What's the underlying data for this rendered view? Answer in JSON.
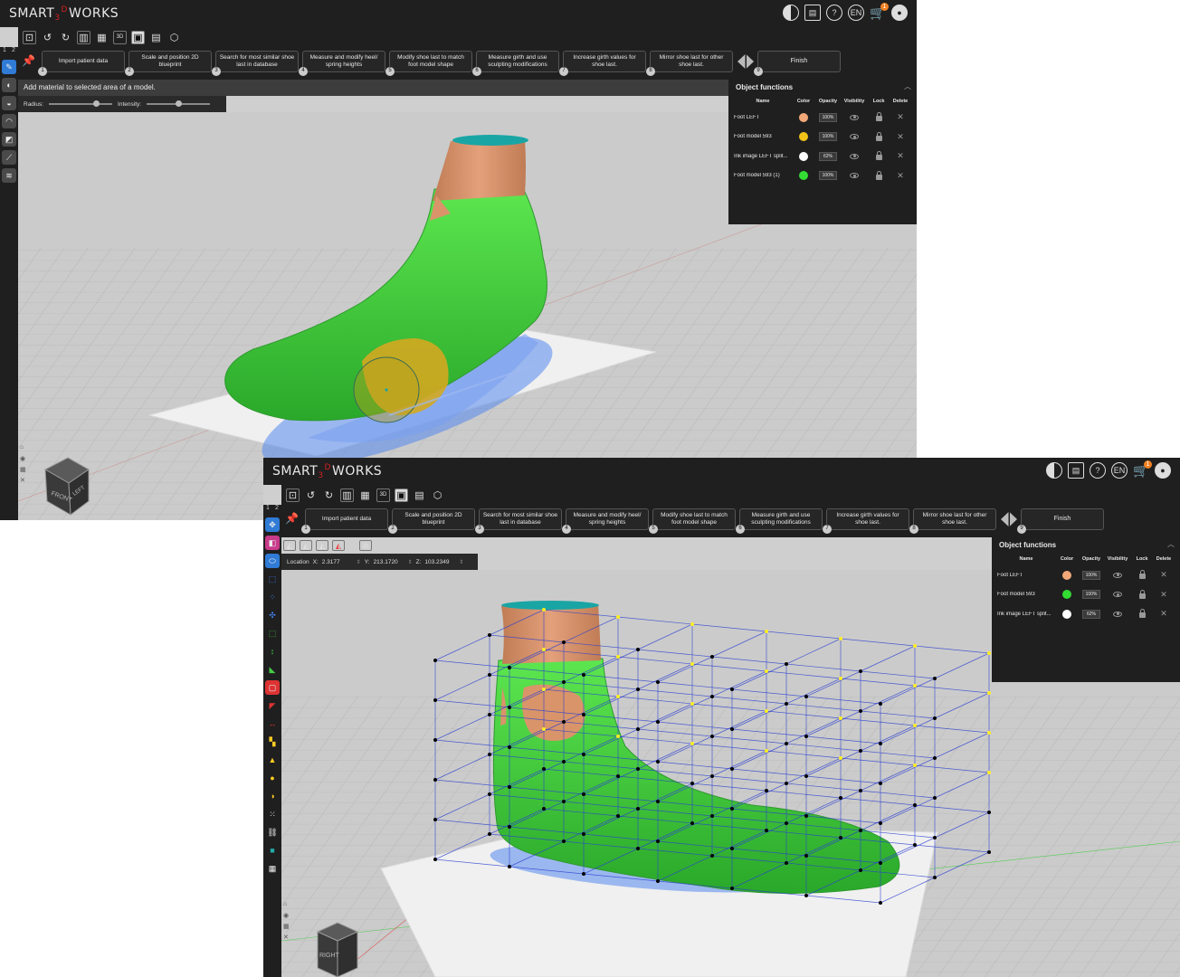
{
  "app": {
    "logo": {
      "pre": "SMART",
      "sub": "3",
      "sup": "D",
      "post": "WORKS"
    },
    "cart_count": "1",
    "language": "EN"
  },
  "steps": [
    {
      "num": "1",
      "label": "Import patient data"
    },
    {
      "num": "2",
      "label": "Scale and position 2D blueprint"
    },
    {
      "num": "3",
      "label": "Search for most similar shoe last in database"
    },
    {
      "num": "4",
      "label": "Measure and modify heel/ spring heights"
    },
    {
      "num": "5",
      "label": "Modify shoe last to match foot model shape"
    },
    {
      "num": "6",
      "label": "Measure girth and use sculpting modifications"
    },
    {
      "num": "7",
      "label": "Increase girth values for shoe last."
    },
    {
      "num": "8",
      "label": "Mirror shoe last for other shoe last."
    },
    {
      "num": "9",
      "label": "Finish"
    }
  ],
  "left_tabs": [
    "1",
    "2"
  ],
  "toolbar_3d_label": "3D",
  "window1": {
    "hint": "Add material to selected area of a model.",
    "radius_label": "Radius:",
    "intensity_label": "Intensity:",
    "radius_value": 0.75,
    "intensity_value": 0.5,
    "navcube": {
      "face1": "FRONT",
      "face2": "LEFT"
    }
  },
  "window2": {
    "location_label": "Location",
    "x_label": "X:",
    "x_value": "2.3177",
    "y_label": "Y:",
    "y_value": "213.1720",
    "z_label": "Z:",
    "z_value": "103.2349",
    "navcube": {
      "face1": "RIGHT"
    }
  },
  "object_panel": {
    "title": "Object functions",
    "columns": {
      "name": "Name",
      "color": "Color",
      "opacity": "Opacity",
      "visibility": "Visibility",
      "lock": "Lock",
      "delete": "Delete"
    }
  },
  "objects_w1": [
    {
      "name": "Foot LEFT",
      "color": "#f2a878",
      "opacity": "100%"
    },
    {
      "name": "Foot model 593",
      "color": "#f2c21a",
      "opacity": "100%"
    },
    {
      "name": "Ink image LEFT split...",
      "color": "#ffffff",
      "opacity": "62%"
    },
    {
      "name": "Foot model 593 (1)",
      "color": "#33dd33",
      "opacity": "100%"
    }
  ],
  "objects_w2": [
    {
      "name": "Foot LEFT",
      "color": "#f2a878",
      "opacity": "100%"
    },
    {
      "name": "Foot model 593",
      "color": "#33dd33",
      "opacity": "100%"
    },
    {
      "name": "Ink image LEFT split...",
      "color": "#ffffff",
      "opacity": "62%"
    }
  ],
  "colors": {
    "foot_green": "#3fd03a",
    "skin": "#d9946a",
    "cuff": "#1aa5a5",
    "ink_blue": "#4a78e8",
    "sculpt_yellow": "#d4a820",
    "cage_line": "#2a3fd0",
    "cage_point_active": "#ffee22"
  },
  "icons": {
    "toolbar": [
      "frame-icon",
      "undo-icon",
      "redo-icon",
      "chart-icon",
      "book-icon",
      "3d-icon",
      "save-icon",
      "report-icon",
      "cube-icon"
    ],
    "topbar": [
      "contrast-icon",
      "calendar-icon",
      "help-icon",
      "language-icon",
      "cart-icon",
      "user-icon"
    ]
  }
}
